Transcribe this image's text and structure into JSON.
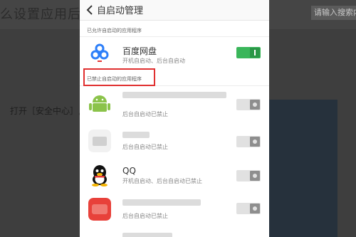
{
  "background": {
    "title": "么设置应用后",
    "search_placeholder": "请输入搜索内",
    "step_text": "打开［安全中心］,"
  },
  "header": {
    "title": "自启动管理"
  },
  "sections": {
    "allowed_label": "已允许自启动的应用程序",
    "blocked_label": "已禁止自启动的应用程序"
  },
  "apps": [
    {
      "name": "百度网盘",
      "subtitle": "开机自启动、后台自启动",
      "enabled": true
    },
    {
      "name": "",
      "subtitle": "后台自启动已禁止",
      "enabled": false
    },
    {
      "name": "",
      "subtitle": "后台自启动已禁止",
      "enabled": false
    },
    {
      "name": "QQ",
      "subtitle": "开机自启动、后台自启动已禁止",
      "enabled": false
    },
    {
      "name": "",
      "subtitle": "后台自启动已禁止",
      "enabled": false
    }
  ],
  "colors": {
    "toggle_on": "#3ab65a",
    "toggle_off": "#e1e1e1",
    "highlight": "#e03030"
  }
}
